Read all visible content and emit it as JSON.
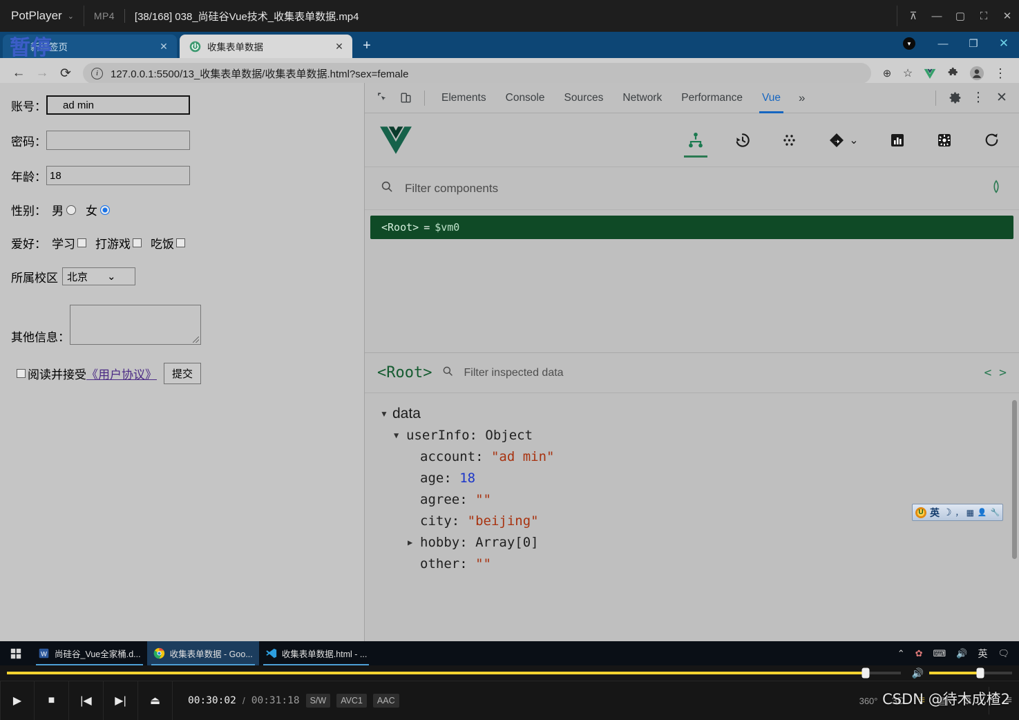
{
  "potplayer": {
    "app_name": "PotPlayer",
    "caret": "⌄",
    "format": "MP4",
    "file_title": "[38/168] 038_尚硅谷Vue技术_收集表单数据.mp4",
    "paused_overlay": "暂停",
    "window_buttons": [
      {
        "name": "pin-button",
        "glyph": "⊼"
      },
      {
        "name": "minimize-button",
        "glyph": "—"
      },
      {
        "name": "maximize-button",
        "glyph": "▢"
      },
      {
        "name": "fullscreen-button",
        "glyph": "⛶"
      },
      {
        "name": "close-button",
        "glyph": "✕"
      }
    ],
    "controls": {
      "play": "▶",
      "stop": "■",
      "previous": "|◀",
      "next": "▶|",
      "eject": "⏏",
      "current_time": "00:30:02",
      "separator": "/",
      "total_time": "00:31:18",
      "badges": [
        "S/W",
        "AVC1",
        "AAC"
      ],
      "right_icons": [
        {
          "name": "360-video-button",
          "label": "360°"
        },
        {
          "name": "3d-video-button",
          "label": "3D"
        },
        {
          "name": "playlist-button",
          "label": "≡"
        },
        {
          "name": "bookmark-button",
          "label": "▤"
        },
        {
          "name": "settings-button",
          "label": "⚙"
        },
        {
          "name": "menu-button",
          "label": "≡"
        }
      ],
      "seek_percent": 96,
      "volume_percent": 62
    },
    "watermark": "CSDN @待木成楂2"
  },
  "chrome": {
    "tabs": [
      {
        "title": "新标签页",
        "active": false,
        "favicon": "blank-favicon",
        "close": "✕"
      },
      {
        "title": "收集表单数据",
        "active": true,
        "favicon": "vue-devtools-favicon",
        "close": "✕"
      }
    ],
    "new_tab_label": "+",
    "window_buttons": [
      {
        "name": "minimize-button",
        "glyph": "—"
      },
      {
        "name": "restore-button",
        "glyph": "❐"
      },
      {
        "name": "close-button",
        "glyph": "✕"
      }
    ],
    "toolbar": {
      "back": "←",
      "forward": "→",
      "reload": "⟳",
      "url": "127.0.0.1:5500/13_收集表单数据/收集表单数据.html?sex=female",
      "info_icon": "i",
      "zoom_icon": "⊕",
      "star_icon": "☆",
      "extension_icons": [
        {
          "name": "vue-extension-icon",
          "glyph": "V"
        },
        {
          "name": "extensions-puzzle-icon",
          "glyph": "🧩"
        },
        {
          "name": "profile-avatar-icon",
          "glyph": "●"
        },
        {
          "name": "chrome-menu-icon",
          "glyph": "⋮"
        }
      ]
    }
  },
  "form": {
    "account": {
      "label": "账号：",
      "value": "ad min",
      "focused": true
    },
    "password": {
      "label": "密码：",
      "value": ""
    },
    "age": {
      "label": "年龄：",
      "value": "18"
    },
    "sex": {
      "label": "性别：",
      "options": [
        {
          "text": "男",
          "checked": false
        },
        {
          "text": "女",
          "checked": true
        }
      ]
    },
    "hobby": {
      "label": "爱好：",
      "options": [
        {
          "text": "学习",
          "checked": false
        },
        {
          "text": "打游戏",
          "checked": false
        },
        {
          "text": "吃饭",
          "checked": false
        }
      ]
    },
    "city": {
      "label": "所属校区",
      "value": "北京",
      "caret": "⌄"
    },
    "other": {
      "label": "其他信息：",
      "value": ""
    },
    "agree": {
      "prefix": "阅读并接受",
      "link": "《用户协议》",
      "checked": false
    },
    "submit": {
      "label": "提交"
    }
  },
  "devtools": {
    "inspect_icon": "⌖",
    "device_icon": "▭",
    "tabs": [
      {
        "label": "Elements",
        "active": false
      },
      {
        "label": "Console",
        "active": false
      },
      {
        "label": "Sources",
        "active": false
      },
      {
        "label": "Network",
        "active": false
      },
      {
        "label": "Performance",
        "active": false
      },
      {
        "label": "Vue",
        "active": true
      }
    ],
    "more_tabs": "»",
    "settings_icon": "⚙",
    "kebab_icon": "⋮",
    "close_icon": "✕",
    "vue": {
      "logo_name": "vue-logo",
      "tools": [
        {
          "name": "components-tree-button",
          "active": true
        },
        {
          "name": "timeline-history-button",
          "active": false
        },
        {
          "name": "vuex-button",
          "active": false
        },
        {
          "name": "router-button",
          "active": false,
          "caret": "⌄"
        },
        {
          "name": "performance-button",
          "active": false
        },
        {
          "name": "settings-button",
          "active": false
        },
        {
          "name": "refresh-button",
          "active": false
        }
      ],
      "filter_placeholder": "Filter components",
      "select_component_icon": "⬡",
      "components": [
        {
          "tag": "<Root>",
          "equals": "=",
          "vm": "$vm0",
          "selected": true
        }
      ],
      "inspector": {
        "root_label": "<Root>",
        "filter_placeholder": "Filter inspected data",
        "code_icon": "< >",
        "sections": [
          {
            "name": "data",
            "expanded": true,
            "arrow": "▼",
            "children": [
              {
                "key": "userInfo",
                "type_label": "Object",
                "arrow": "▼",
                "expanded": true,
                "props": [
                  {
                    "key": "account",
                    "value": "\"ad min\"",
                    "kind": "string",
                    "arrow": ""
                  },
                  {
                    "key": "age",
                    "value": "18",
                    "kind": "number",
                    "arrow": ""
                  },
                  {
                    "key": "agree",
                    "value": "\"\"",
                    "kind": "string",
                    "arrow": ""
                  },
                  {
                    "key": "city",
                    "value": "\"beijing\"",
                    "kind": "string",
                    "arrow": ""
                  },
                  {
                    "key": "hobby",
                    "value": "Array[0]",
                    "kind": "type",
                    "arrow": "▶"
                  },
                  {
                    "key": "other",
                    "value": "\"\"",
                    "kind": "string",
                    "arrow": ""
                  }
                ]
              }
            ]
          }
        ]
      }
    }
  },
  "taskbar": {
    "start_label": "⊞",
    "items": [
      {
        "title": "尚硅谷_Vue全家桶.d...",
        "icon": "word-icon",
        "active": false
      },
      {
        "title": "收集表单数据 - Goo...",
        "icon": "chrome-icon",
        "active": true
      },
      {
        "title": "收集表单数据.html - ...",
        "icon": "vscode-icon",
        "active": false
      }
    ],
    "tray": [
      {
        "name": "show-hidden-icons",
        "glyph": "⌃"
      },
      {
        "name": "antivirus-icon",
        "glyph": "✿"
      },
      {
        "name": "usb-device-icon",
        "glyph": "⌨"
      },
      {
        "name": "volume-icon",
        "glyph": "🔊"
      },
      {
        "name": "ime-language-icon",
        "glyph": "英"
      },
      {
        "name": "action-center-icon",
        "glyph": "🗨"
      }
    ]
  },
  "ime": {
    "items": [
      {
        "name": "sogou-logo-icon",
        "glyph": "U"
      },
      {
        "name": "language-mode-icon",
        "glyph": "英"
      },
      {
        "name": "moon-mode-icon",
        "glyph": "☽"
      },
      {
        "name": "punctuation-icon",
        "glyph": "，"
      },
      {
        "name": "soft-keyboard-icon",
        "glyph": "▦"
      },
      {
        "name": "user-icon",
        "glyph": "👤"
      },
      {
        "name": "toolbox-icon",
        "glyph": "🔧"
      }
    ]
  }
}
